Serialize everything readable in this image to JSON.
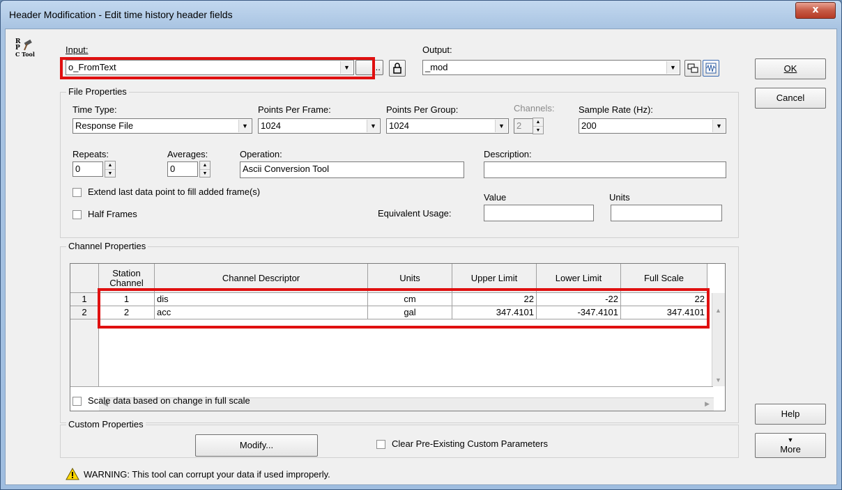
{
  "window": {
    "title": "Header Modification - Edit time history header fields",
    "close_glyph": "x"
  },
  "logo": {
    "lines": [
      "R",
      "P",
      "C Tool"
    ]
  },
  "input": {
    "label": "Input:",
    "value": "o_FromText",
    "browse_label": "..."
  },
  "output": {
    "label": "Output:",
    "value": "_mod"
  },
  "buttons": {
    "ok": "OK",
    "cancel": "Cancel",
    "help": "Help",
    "more": "More",
    "more_glyph": "▼"
  },
  "file_properties": {
    "title": "File Properties",
    "time_type": {
      "label": "Time Type:",
      "value": "Response File"
    },
    "points_per_frame": {
      "label": "Points Per Frame:",
      "value": "1024"
    },
    "points_per_group": {
      "label": "Points Per Group:",
      "value": "1024"
    },
    "channels": {
      "label": "Channels:",
      "value": "2"
    },
    "sample_rate": {
      "label": "Sample Rate (Hz):",
      "value": "200"
    },
    "repeats": {
      "label": "Repeats:",
      "value": "0"
    },
    "averages": {
      "label": "Averages:",
      "value": "0"
    },
    "operation": {
      "label": "Operation:",
      "value": "Ascii Conversion Tool"
    },
    "description": {
      "label": "Description:",
      "value": ""
    },
    "extend_label": "Extend last data point to fill added frame(s)",
    "half_frames_label": "Half Frames",
    "equivalent_usage_label": "Equivalent Usage:",
    "value_label": "Value",
    "units_label": "Units",
    "eq_value": "",
    "eq_units": ""
  },
  "channel_properties": {
    "title": "Channel Properties",
    "columns": [
      "Station Channel",
      "Channel Descriptor",
      "Units",
      "Upper Limit",
      "Lower Limit",
      "Full Scale"
    ],
    "rows": [
      {
        "row": "1",
        "station": "1",
        "descriptor": "dis",
        "units": "cm",
        "upper": "22",
        "lower": "-22",
        "full": "22"
      },
      {
        "row": "2",
        "station": "2",
        "descriptor": "acc",
        "units": "gal",
        "upper": "347.4101",
        "lower": "-347.4101",
        "full": "347.4101"
      }
    ],
    "scale_label": "Scale data based on change in full scale"
  },
  "custom_properties": {
    "title": "Custom Properties",
    "modify_label": "Modify...",
    "clear_label": "Clear Pre-Existing Custom Parameters"
  },
  "warning": {
    "text": "WARNING: This tool can corrupt your data if used improperly."
  },
  "colors": {
    "highlight": "#e01010",
    "client_bg": "#f0f0f0"
  }
}
